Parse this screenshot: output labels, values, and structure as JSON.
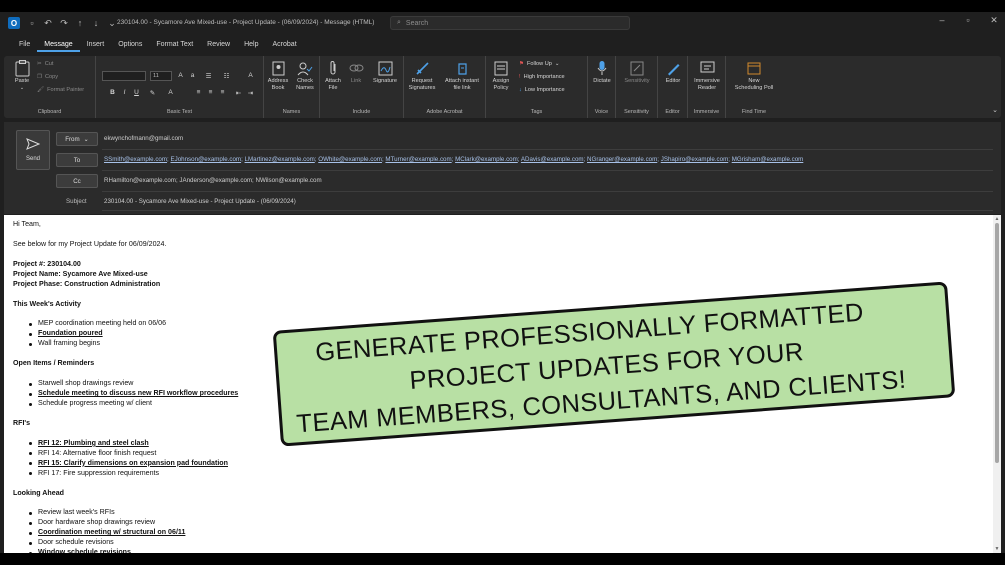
{
  "title_bar": {
    "app_logo": "O",
    "title": "230104.00 - Sycamore Ave Mixed-use - Project Update - (06/09/2024)  -  Message (HTML)",
    "search_placeholder": "Search"
  },
  "menu": [
    "File",
    "Message",
    "Insert",
    "Options",
    "Format Text",
    "Review",
    "Help",
    "Acrobat"
  ],
  "menu_active": "Message",
  "ribbon": {
    "clipboard": {
      "label": "Clipboard",
      "paste": "Paste",
      "cut": "Cut",
      "copy": "Copy",
      "format_painter": "Format Painter"
    },
    "basic_text": {
      "label": "Basic Text",
      "font_size": "11"
    },
    "names": {
      "label": "Names",
      "address_book": [
        "Address",
        "Book"
      ],
      "check_names": [
        "Check",
        "Names"
      ]
    },
    "include": {
      "label": "Include",
      "attach_file": [
        "Attach",
        "File"
      ],
      "link": "Link",
      "signature": "Signature"
    },
    "acrobat": {
      "label": "Adobe Acrobat",
      "request_signatures": [
        "Request",
        "Signatures"
      ],
      "attach_instant": [
        "Attach instant",
        "file link"
      ]
    },
    "tags": {
      "label": "Tags",
      "assign_policy": [
        "Assign",
        "Policy"
      ],
      "follow_up": "Follow Up",
      "high_importance": "High Importance",
      "low_importance": "Low Importance"
    },
    "voice": {
      "label": "Voice",
      "dictate": "Dictate"
    },
    "sensitivity": {
      "label": "Sensitivity",
      "sensitivity": "Sensitivity"
    },
    "editor": {
      "label": "Editor",
      "editor": "Editor"
    },
    "immersive": {
      "label": "Immersive",
      "immersive_reader": [
        "Immersive",
        "Reader"
      ]
    },
    "find_time": {
      "label": "Find Time",
      "new_scheduling": [
        "New",
        "Scheduling Poll"
      ]
    }
  },
  "compose": {
    "send": "Send",
    "from_label": "From",
    "from_value": "ekwynchofmann@gmail.com",
    "to_label": "To",
    "to_recipients": [
      "SSmith@example.com",
      "EJohnson@example.com",
      "LMartinez@example.com",
      "OWhite@example.com",
      "MTurner@example.com",
      "MClark@example.com",
      "ADavis@example.com",
      "NGranger@example.com",
      "JShapiro@example.com",
      "MGrisham@example.com"
    ],
    "cc_label": "Cc",
    "cc_value": "RHamilton@example.com; JAnderson@example.com; NWilson@example.com",
    "subject_label": "Subject",
    "subject_value": "230104.00 - Sycamore Ave Mixed-use - Project Update - (06/09/2024)"
  },
  "body": {
    "greeting": "Hi Team,",
    "intro": "See below for my Project Update for 06/09/2024.",
    "project_number": "Project #: 230104.00",
    "project_name": "Project Name: Sycamore Ave Mixed-use",
    "project_phase": "Project Phase: Construction Administration",
    "sections": [
      {
        "heading": "This Week's Activity",
        "items": [
          {
            "text": "MEP coordination meeting held on 06/06",
            "link": false
          },
          {
            "text": "Foundation poured",
            "link": true
          },
          {
            "text": "Wall framing begins",
            "link": false
          }
        ]
      },
      {
        "heading": "Open Items / Reminders",
        "items": [
          {
            "text": "Starwell shop drawings review",
            "link": false
          },
          {
            "text": "Schedule meeting to discuss new RFI workflow procedures",
            "link": true
          },
          {
            "text": "Schedule progress meeting w/ client",
            "link": false
          }
        ]
      },
      {
        "heading": "RFI's",
        "items": [
          {
            "text": "RFI 12: Plumbing and steel clash",
            "link": true
          },
          {
            "text": "RFI 14: Alternative floor finish request",
            "link": false
          },
          {
            "text": "RFI 15: Clarify dimensions on expansion pad foundation",
            "link": true
          },
          {
            "text": "RFI 17: Fire suppression requirements",
            "link": false
          }
        ]
      },
      {
        "heading": "Looking Ahead",
        "items": [
          {
            "text": "Review last week's RFIs",
            "link": false
          },
          {
            "text": "Door hardware shop drawings review",
            "link": false
          },
          {
            "text": "Coordination meeting w/ structural on 06/11",
            "link": true
          },
          {
            "text": "Door schedule revisions",
            "link": false
          },
          {
            "text": "Window schedule revisions",
            "link": true
          }
        ]
      }
    ]
  },
  "banner": {
    "line1": "Generate professionally formatted",
    "line2": "project updates for your",
    "line3": "team members, consultants, and clients!"
  },
  "colors": {
    "banner_bg": "#b8e0a4",
    "accent": "#4ea1e8",
    "recipient_link": "#a7c1e8"
  }
}
